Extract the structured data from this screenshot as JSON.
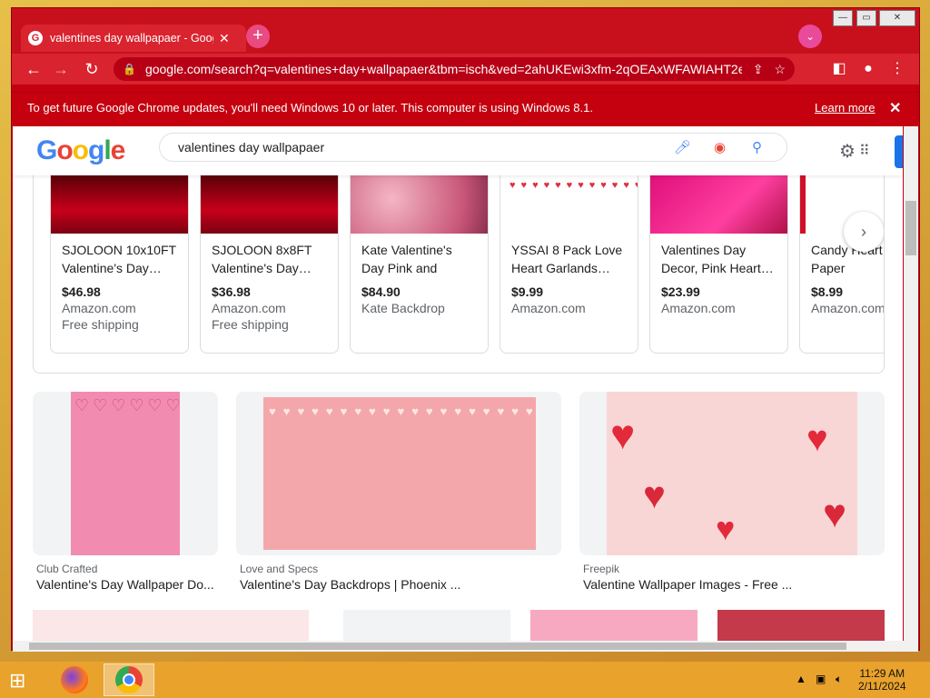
{
  "browser": {
    "tab_title": "valentines day wallpapaer - Goog",
    "url": "google.com/search?q=valentines+day+wallpapaer&tbm=isch&ved=2ahUKEwi3xfm-2qOEAxWFAWIAHT2eA...",
    "infobar_text": "To get future Google Chrome updates, you'll need Windows 10 or later. This computer is using Windows 8.1.",
    "infobar_link": "Learn more"
  },
  "google": {
    "logo": "Google",
    "query": "valentines day wallpapaer"
  },
  "shopping": [
    {
      "title": "SJOLOON 10x10FT Valentine's Day…",
      "price": "$46.98",
      "store": "Amazon.com",
      "shipping": "Free shipping"
    },
    {
      "title": "SJOLOON 8x8FT Valentine's Day…",
      "price": "$36.98",
      "store": "Amazon.com",
      "shipping": "Free shipping"
    },
    {
      "title": "Kate Valentine's Day Pink and Silve…",
      "price": "$84.90",
      "store": "Kate Backdrop",
      "shipping": ""
    },
    {
      "title": "YSSAI 8 Pack Love Heart Garlands…",
      "price": "$9.99",
      "store": "Amazon.com",
      "shipping": ""
    },
    {
      "title": "Valentines Day Decor, Pink Heart…",
      "price": "$23.99",
      "store": "Amazon.com",
      "shipping": ""
    },
    {
      "title": "Candy Heart Letter Paper",
      "price": "$8.99",
      "store": "Amazon.com",
      "shipping": ""
    }
  ],
  "results": [
    {
      "source": "Club Crafted",
      "title": "Valentine's Day Wallpaper Do..."
    },
    {
      "source": "Love and Specs",
      "title": "Valentine's Day Backdrops | Phoenix ..."
    },
    {
      "source": "Freepik",
      "title": "Valentine Wallpaper Images - Free ..."
    }
  ],
  "clock": {
    "time": "11:29 AM",
    "date": "2/11/2024"
  },
  "colors": {
    "chrome_red": "#c8101c",
    "google_blue": "#4285f4",
    "google_red": "#ea4335",
    "google_yellow": "#fbbc05",
    "google_green": "#34a853"
  },
  "icons": [
    "back-icon",
    "forward-icon",
    "reload-icon",
    "lock-icon",
    "share-icon",
    "star-icon",
    "sidebar-icon",
    "profile-icon",
    "menu-icon",
    "mic-icon",
    "lens-icon",
    "search-icon",
    "settings-icon",
    "apps-icon",
    "windows-start-icon",
    "firefox-icon",
    "chrome-icon"
  ]
}
